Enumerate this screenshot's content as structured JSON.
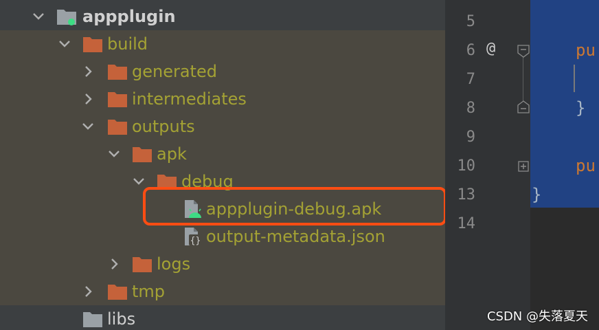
{
  "project_tree": {
    "module": "appplugin",
    "build": "build",
    "generated": "generated",
    "intermediates": "intermediates",
    "outputs": "outputs",
    "apk": "apk",
    "debug": "debug",
    "apk_file": "appplugin-debug.apk",
    "metadata_file": "output-metadata.json",
    "logs": "logs",
    "tmp": "tmp",
    "libs": "libs"
  },
  "editor": {
    "line_numbers": [
      "5",
      "6",
      "7",
      "8",
      "9",
      "10",
      "13",
      "14"
    ],
    "annotation_marker": "@",
    "code_line_6": "pu",
    "code_line_8": "}",
    "code_line_10": "pu",
    "code_line_13": "}"
  },
  "watermark": "CSDN @失落夏天",
  "colors": {
    "tree_background": "#4b4840",
    "folder": "#c5623a",
    "highlight_border": "#ff4d13",
    "keyword": "#cc7832",
    "selection": "#214283",
    "android_green": "#3ddc84"
  }
}
